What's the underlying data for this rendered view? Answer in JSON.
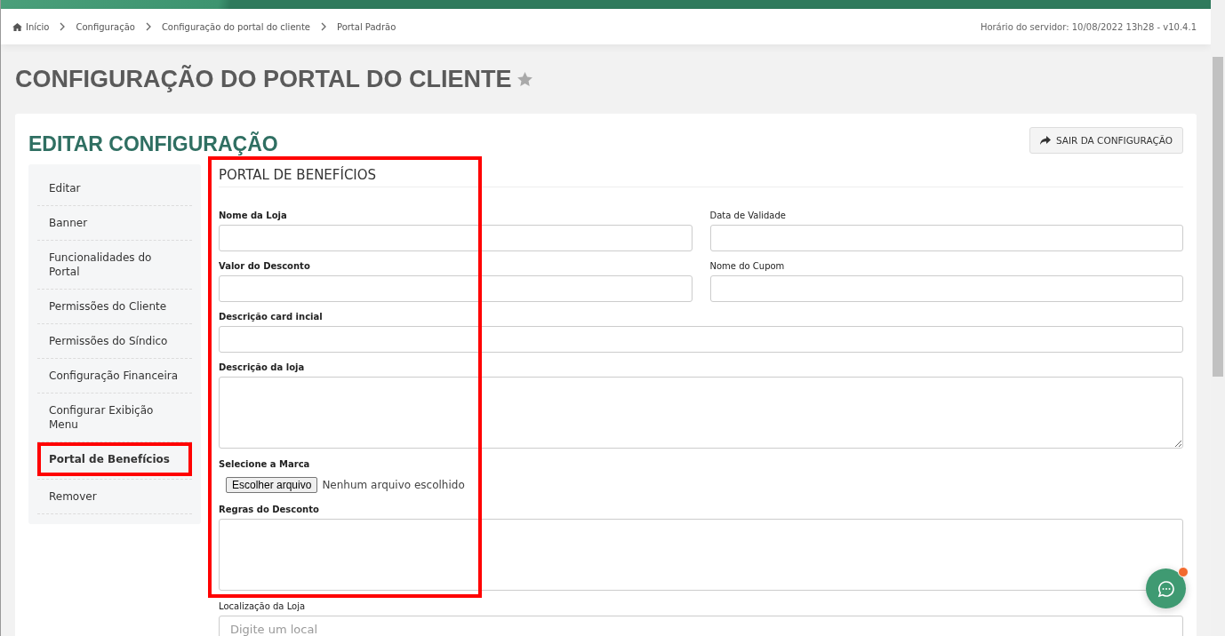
{
  "breadcrumb": [
    {
      "label": "Início",
      "home": true
    },
    {
      "label": "Configuração",
      "home": false
    },
    {
      "label": "Configuração do portal do cliente",
      "home": false
    },
    {
      "label": "Portal Padrão",
      "home": false
    }
  ],
  "server_time": "Horário do servidor: 10/08/2022 13h28 - v10.4.1",
  "page_title": "CONFIGURAÇÃO DO PORTAL DO CLIENTE",
  "card_title": "EDITAR CONFIGURAÇÃO",
  "exit_button": "SAIR DA CONFIGURAÇÃO",
  "sidebar": {
    "items": [
      {
        "label": "Editar",
        "selected": false,
        "highlighted": false
      },
      {
        "label": "Banner",
        "selected": false,
        "highlighted": false
      },
      {
        "label": "Funcionalidades do Portal",
        "selected": false,
        "highlighted": false
      },
      {
        "label": "Permissões do Cliente",
        "selected": false,
        "highlighted": false
      },
      {
        "label": "Permissões do Síndico",
        "selected": false,
        "highlighted": false
      },
      {
        "label": "Configuração Financeira",
        "selected": false,
        "highlighted": false
      },
      {
        "label": "Configurar Exibição Menu",
        "selected": false,
        "highlighted": false
      },
      {
        "label": "Portal de Benefícios",
        "selected": true,
        "highlighted": true
      },
      {
        "label": "Remover",
        "selected": false,
        "highlighted": false
      }
    ]
  },
  "form": {
    "section_title": "PORTAL DE BENEFÍCIOS",
    "highlighted": true,
    "rows": [
      [
        {
          "kind": "text",
          "label": "Nome da Loja",
          "bold": true
        },
        {
          "kind": "text",
          "label": "Data de Validade",
          "bold": false
        }
      ],
      [
        {
          "kind": "text",
          "label": "Valor do Desconto",
          "bold": true
        },
        {
          "kind": "text",
          "label": "Nome do Cupom",
          "bold": false
        }
      ],
      [
        {
          "kind": "text",
          "label": "Descrição card incial",
          "bold": true
        }
      ],
      [
        {
          "kind": "textarea",
          "label": "Descrição da loja",
          "bold": true
        }
      ],
      [
        {
          "kind": "file",
          "label": "Selecione a Marca",
          "bold": true,
          "button": "Escolher arquivo",
          "status": "Nenhum arquivo escolhido"
        }
      ],
      [
        {
          "kind": "textarea",
          "label": "Regras do Desconto",
          "bold": true
        }
      ],
      [
        {
          "kind": "text",
          "label": "Localização da Loja",
          "bold": false,
          "placeholder": "Digite um local"
        }
      ]
    ]
  },
  "chat": {
    "notification": true
  }
}
